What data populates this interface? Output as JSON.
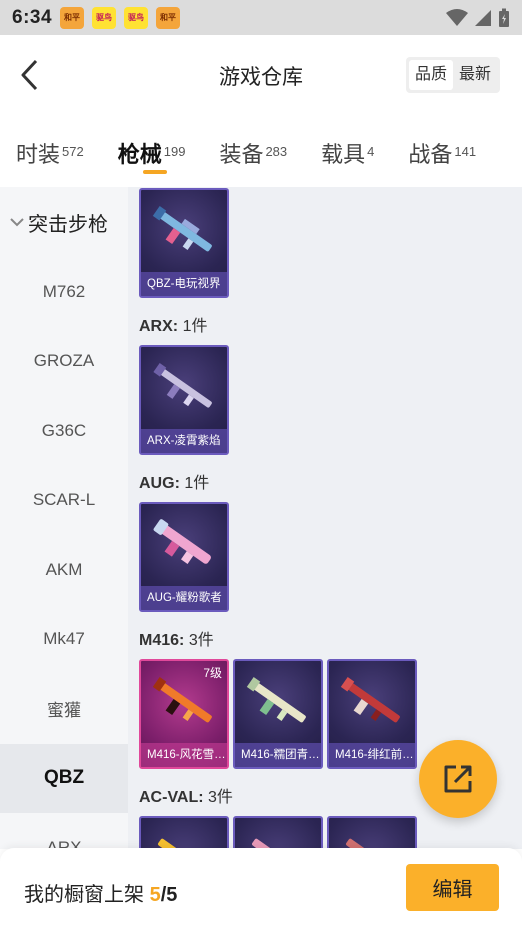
{
  "status_bar": {
    "time": "6:34",
    "apps": [
      {
        "icon": "game-app-badge",
        "label": "和平",
        "style": "orange"
      },
      {
        "icon": "deal-app-badge",
        "label": "驱鸟",
        "style": "yellow"
      },
      {
        "icon": "deal-app-badge",
        "label": "驱鸟",
        "style": "yellow"
      },
      {
        "icon": "game-app-badge",
        "label": "和平",
        "style": "orange"
      }
    ],
    "icons": [
      "wifi-icon",
      "cell-signal-icon",
      "battery-icon"
    ]
  },
  "header": {
    "title": "游戏仓库",
    "sort_options": [
      "品质",
      "最新"
    ],
    "sort_active": "品质"
  },
  "tabs": [
    {
      "label": "时装",
      "count": "572"
    },
    {
      "label": "枪械",
      "count": "199",
      "active": true
    },
    {
      "label": "装备",
      "count": "283"
    },
    {
      "label": "载具",
      "count": "4"
    },
    {
      "label": "战备",
      "count": "141"
    }
  ],
  "sidebar": {
    "group": "突击步枪",
    "items": [
      "M762",
      "GROZA",
      "G36C",
      "SCAR-L",
      "AKM",
      "Mk47",
      "蜜獾",
      "QBZ",
      "ARX"
    ],
    "active": "QBZ"
  },
  "content": {
    "top_card": {
      "label": "QBZ-电玩视界"
    },
    "groups": [
      {
        "name": "ARX",
        "count": "1件",
        "cards": [
          {
            "label": "ARX-凌霄紫焰"
          }
        ]
      },
      {
        "name": "AUG",
        "count": "1件",
        "cards": [
          {
            "label": "AUG-耀粉歌者"
          }
        ]
      },
      {
        "name": "M416",
        "count": "3件",
        "cards": [
          {
            "label": "M416-风花雪…",
            "level": "7级",
            "style": "pink"
          },
          {
            "label": "M416-糯团青…"
          },
          {
            "label": "M416-绯红前…"
          }
        ]
      },
      {
        "name": "AC-VAL",
        "count": "3件",
        "cards": [
          {
            "label": ""
          },
          {
            "label": ""
          },
          {
            "label": ""
          }
        ]
      }
    ]
  },
  "bottom_bar": {
    "shelf_label": "我的橱窗上架",
    "shelf_used": "5",
    "shelf_sep": "/",
    "shelf_total": "5",
    "edit_label": "编辑"
  },
  "colors": {
    "accent": "#f5a623",
    "fab": "#fbb02a",
    "card_border": "#6b5bbd",
    "card_border_pink": "#e0489a"
  }
}
